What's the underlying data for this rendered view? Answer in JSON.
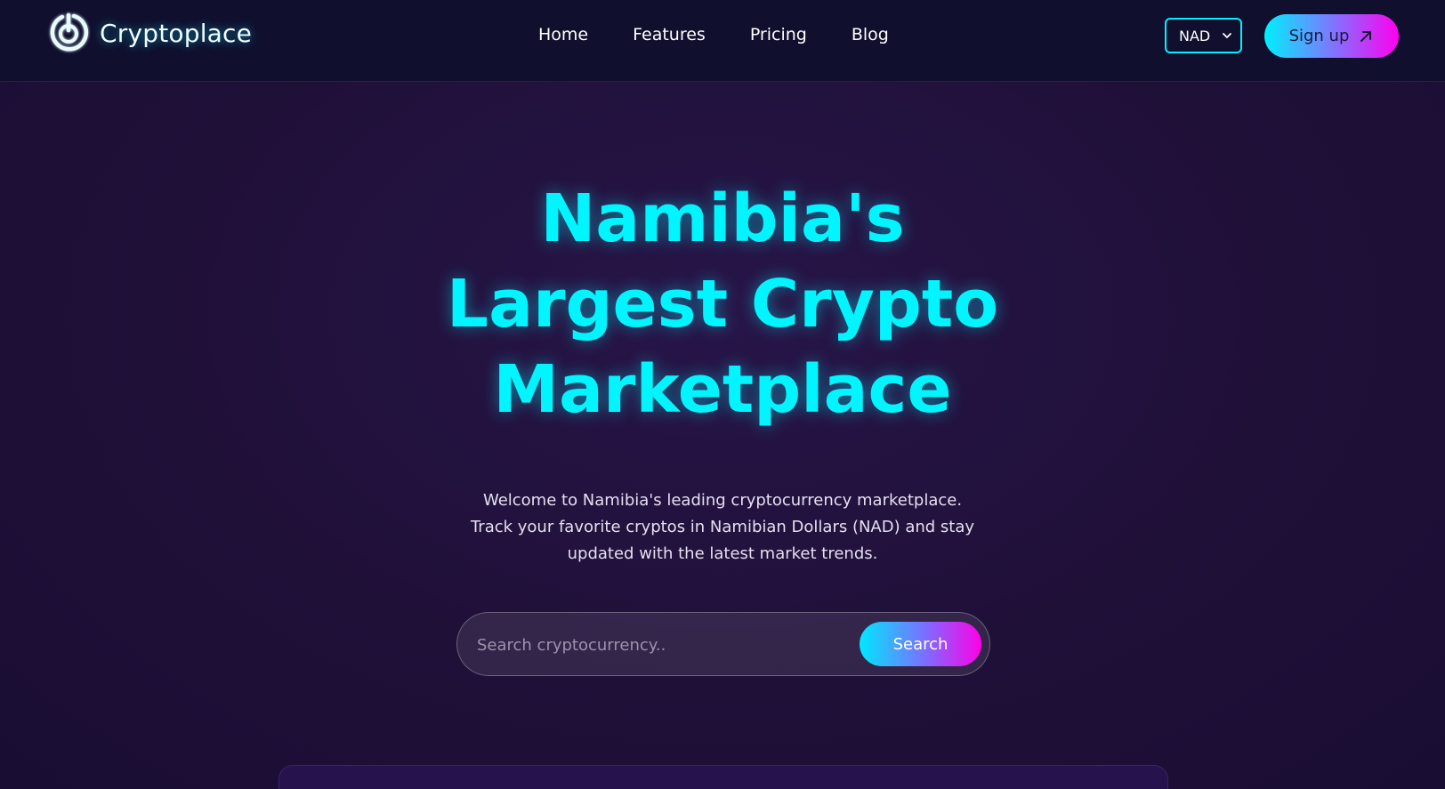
{
  "brand": {
    "name": "Cryptoplace",
    "logo_icon": "power-ring-icon"
  },
  "nav": {
    "links": [
      {
        "label": "Home"
      },
      {
        "label": "Features"
      },
      {
        "label": "Pricing"
      },
      {
        "label": "Blog"
      }
    ]
  },
  "currency": {
    "selected": "NAD",
    "icon": "chevron-down-icon"
  },
  "signup": {
    "label": "Sign up",
    "icon": "arrow-up-right-icon"
  },
  "hero": {
    "title_lines": [
      "Namibia's",
      "Largest Crypto",
      "Marketplace"
    ],
    "description_lines": [
      "Welcome to Namibia's leading cryptocurrency marketplace.",
      "Track your favorite cryptos in Namibian Dollars (NAD) and stay",
      "updated with the latest market trends."
    ]
  },
  "search": {
    "placeholder": "Search cryptocurrency..",
    "value": "",
    "button_label": "Search"
  },
  "colors": {
    "accent_cyan": "#00f5ff",
    "accent_magenta": "#ff00ee",
    "navbar_bg": "#100f2e",
    "page_bg": "#1f0f3c"
  }
}
